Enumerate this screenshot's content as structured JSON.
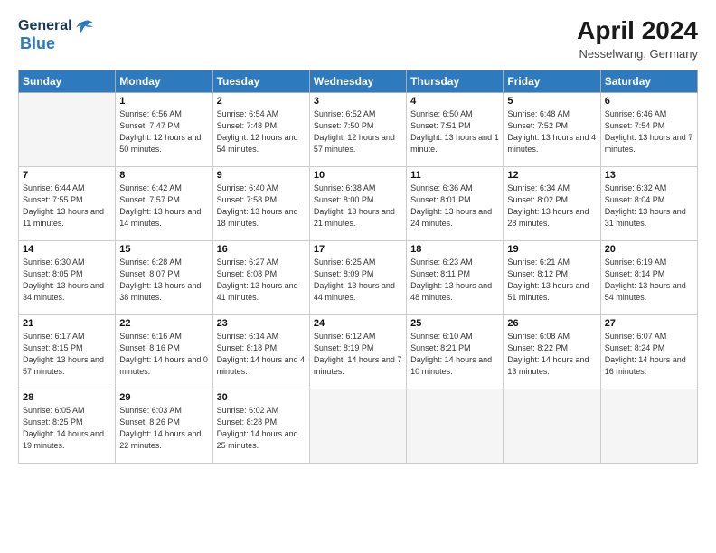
{
  "header": {
    "logo_general": "General",
    "logo_blue": "Blue",
    "month": "April 2024",
    "location": "Nesselwang, Germany"
  },
  "weekdays": [
    "Sunday",
    "Monday",
    "Tuesday",
    "Wednesday",
    "Thursday",
    "Friday",
    "Saturday"
  ],
  "weeks": [
    [
      {
        "day": "",
        "empty": true
      },
      {
        "day": "1",
        "sunrise": "6:56 AM",
        "sunset": "7:47 PM",
        "daylight": "12 hours and 50 minutes."
      },
      {
        "day": "2",
        "sunrise": "6:54 AM",
        "sunset": "7:48 PM",
        "daylight": "12 hours and 54 minutes."
      },
      {
        "day": "3",
        "sunrise": "6:52 AM",
        "sunset": "7:50 PM",
        "daylight": "12 hours and 57 minutes."
      },
      {
        "day": "4",
        "sunrise": "6:50 AM",
        "sunset": "7:51 PM",
        "daylight": "13 hours and 1 minute."
      },
      {
        "day": "5",
        "sunrise": "6:48 AM",
        "sunset": "7:52 PM",
        "daylight": "13 hours and 4 minutes."
      },
      {
        "day": "6",
        "sunrise": "6:46 AM",
        "sunset": "7:54 PM",
        "daylight": "13 hours and 7 minutes."
      }
    ],
    [
      {
        "day": "7",
        "sunrise": "6:44 AM",
        "sunset": "7:55 PM",
        "daylight": "13 hours and 11 minutes."
      },
      {
        "day": "8",
        "sunrise": "6:42 AM",
        "sunset": "7:57 PM",
        "daylight": "13 hours and 14 minutes."
      },
      {
        "day": "9",
        "sunrise": "6:40 AM",
        "sunset": "7:58 PM",
        "daylight": "13 hours and 18 minutes."
      },
      {
        "day": "10",
        "sunrise": "6:38 AM",
        "sunset": "8:00 PM",
        "daylight": "13 hours and 21 minutes."
      },
      {
        "day": "11",
        "sunrise": "6:36 AM",
        "sunset": "8:01 PM",
        "daylight": "13 hours and 24 minutes."
      },
      {
        "day": "12",
        "sunrise": "6:34 AM",
        "sunset": "8:02 PM",
        "daylight": "13 hours and 28 minutes."
      },
      {
        "day": "13",
        "sunrise": "6:32 AM",
        "sunset": "8:04 PM",
        "daylight": "13 hours and 31 minutes."
      }
    ],
    [
      {
        "day": "14",
        "sunrise": "6:30 AM",
        "sunset": "8:05 PM",
        "daylight": "13 hours and 34 minutes."
      },
      {
        "day": "15",
        "sunrise": "6:28 AM",
        "sunset": "8:07 PM",
        "daylight": "13 hours and 38 minutes."
      },
      {
        "day": "16",
        "sunrise": "6:27 AM",
        "sunset": "8:08 PM",
        "daylight": "13 hours and 41 minutes."
      },
      {
        "day": "17",
        "sunrise": "6:25 AM",
        "sunset": "8:09 PM",
        "daylight": "13 hours and 44 minutes."
      },
      {
        "day": "18",
        "sunrise": "6:23 AM",
        "sunset": "8:11 PM",
        "daylight": "13 hours and 48 minutes."
      },
      {
        "day": "19",
        "sunrise": "6:21 AM",
        "sunset": "8:12 PM",
        "daylight": "13 hours and 51 minutes."
      },
      {
        "day": "20",
        "sunrise": "6:19 AM",
        "sunset": "8:14 PM",
        "daylight": "13 hours and 54 minutes."
      }
    ],
    [
      {
        "day": "21",
        "sunrise": "6:17 AM",
        "sunset": "8:15 PM",
        "daylight": "13 hours and 57 minutes."
      },
      {
        "day": "22",
        "sunrise": "6:16 AM",
        "sunset": "8:16 PM",
        "daylight": "14 hours and 0 minutes."
      },
      {
        "day": "23",
        "sunrise": "6:14 AM",
        "sunset": "8:18 PM",
        "daylight": "14 hours and 4 minutes."
      },
      {
        "day": "24",
        "sunrise": "6:12 AM",
        "sunset": "8:19 PM",
        "daylight": "14 hours and 7 minutes."
      },
      {
        "day": "25",
        "sunrise": "6:10 AM",
        "sunset": "8:21 PM",
        "daylight": "14 hours and 10 minutes."
      },
      {
        "day": "26",
        "sunrise": "6:08 AM",
        "sunset": "8:22 PM",
        "daylight": "14 hours and 13 minutes."
      },
      {
        "day": "27",
        "sunrise": "6:07 AM",
        "sunset": "8:24 PM",
        "daylight": "14 hours and 16 minutes."
      }
    ],
    [
      {
        "day": "28",
        "sunrise": "6:05 AM",
        "sunset": "8:25 PM",
        "daylight": "14 hours and 19 minutes."
      },
      {
        "day": "29",
        "sunrise": "6:03 AM",
        "sunset": "8:26 PM",
        "daylight": "14 hours and 22 minutes."
      },
      {
        "day": "30",
        "sunrise": "6:02 AM",
        "sunset": "8:28 PM",
        "daylight": "14 hours and 25 minutes."
      },
      {
        "day": "",
        "empty": true
      },
      {
        "day": "",
        "empty": true
      },
      {
        "day": "",
        "empty": true
      },
      {
        "day": "",
        "empty": true
      }
    ]
  ],
  "labels": {
    "sunrise": "Sunrise:",
    "sunset": "Sunset:",
    "daylight": "Daylight:"
  }
}
